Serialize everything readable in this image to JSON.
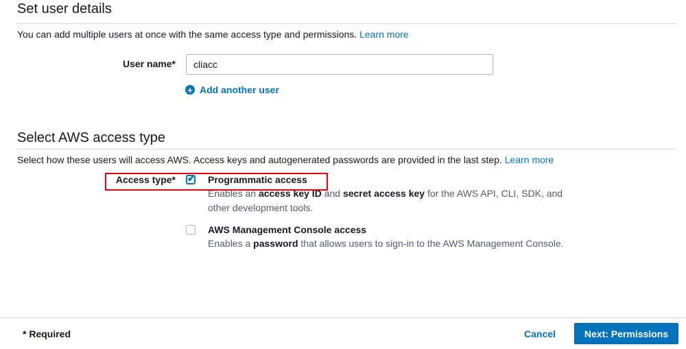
{
  "user_details": {
    "title": "Set user details",
    "description": "You can add multiple users at once with the same access type and permissions.",
    "learn_more": "Learn more",
    "username_label": "User name*",
    "username_value": "cliacc",
    "add_another_user": "Add another user"
  },
  "access_type": {
    "title": "Select AWS access type",
    "description": "Select how these users will access AWS. Access keys and autogenerated passwords are provided in the last step.",
    "learn_more": "Learn more",
    "label": "Access type*",
    "options": [
      {
        "title": "Programmatic access",
        "checked": true,
        "desc_parts": [
          "Enables an ",
          "access key ID",
          " and ",
          "secret access key",
          " for the AWS API, CLI, SDK, and other development tools."
        ]
      },
      {
        "title": "AWS Management Console access",
        "checked": false,
        "desc_parts": [
          "Enables a ",
          "password",
          " that allows users to sign-in to the AWS Management Console."
        ]
      }
    ]
  },
  "footer": {
    "required_note": "* Required",
    "cancel_label": "Cancel",
    "next_label": "Next: Permissions"
  },
  "colors": {
    "accent": "#0073bb",
    "highlight": "#e3000f"
  }
}
